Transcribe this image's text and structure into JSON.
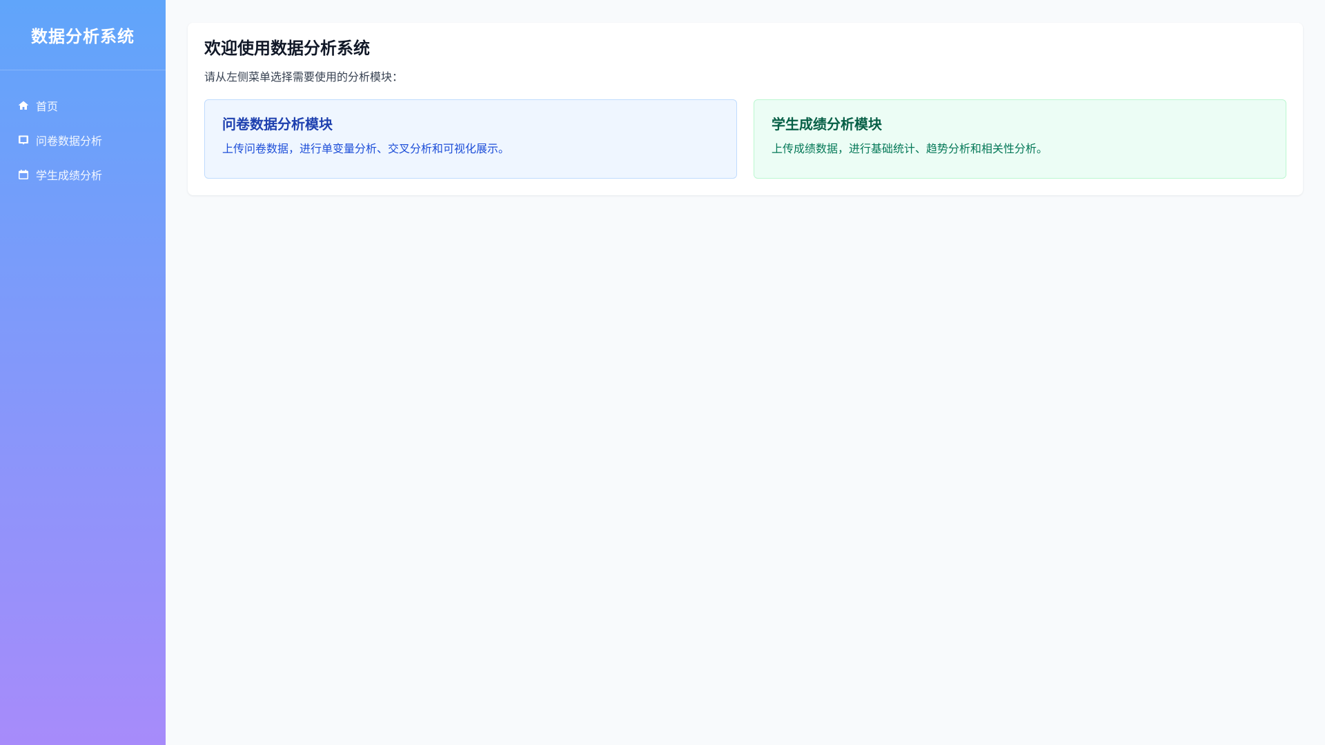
{
  "app": {
    "title": "数据分析系统"
  },
  "sidebar": {
    "items": [
      {
        "label": "首页",
        "icon": "home-icon"
      },
      {
        "label": "问卷数据分析",
        "icon": "survey-icon"
      },
      {
        "label": "学生成绩分析",
        "icon": "calendar-icon"
      }
    ]
  },
  "main": {
    "title": "欢迎使用数据分析系统",
    "subtitle": "请从左侧菜单选择需要使用的分析模块：",
    "modules": [
      {
        "title": "问卷数据分析模块",
        "description": "上传问卷数据，进行单变量分析、交叉分析和可视化展示。",
        "color": "#eff6ff"
      },
      {
        "title": "学生成绩分析模块",
        "description": "上传成绩数据，进行基础统计、趋势分析和相关性分析。",
        "color": "#ecfdf5"
      }
    ]
  },
  "colors": {
    "sidebar_gradient_start": "#60a5fa",
    "sidebar_gradient_end": "#a78bfa",
    "background": "#f8fafc"
  }
}
